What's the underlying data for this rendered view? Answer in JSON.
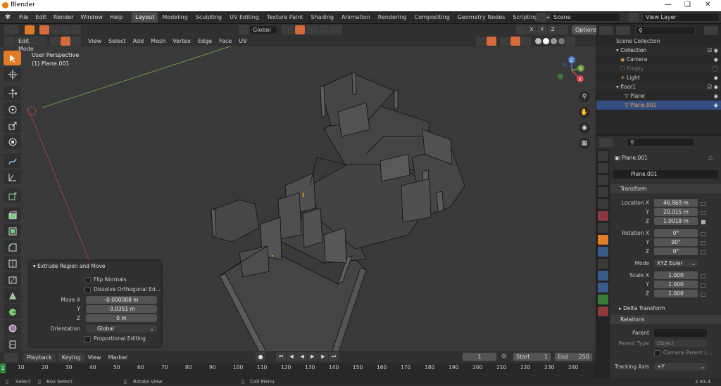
{
  "window": {
    "title": "Blender"
  },
  "menus": [
    "File",
    "Edit",
    "Render",
    "Window",
    "Help"
  ],
  "workspaces": [
    "Layout",
    "Modeling",
    "Sculpting",
    "UV Editing",
    "Texture Paint",
    "Shading",
    "Animation",
    "Rendering",
    "Compositing",
    "Geometry Nodes",
    "Scripting"
  ],
  "topbar": {
    "add_tab": "+",
    "scene": "Scene",
    "view_layer": "View Layer"
  },
  "viewport": {
    "orientation": "Global",
    "options": "Options",
    "axes": [
      "X",
      "Y",
      "Z"
    ],
    "mode": "Edit Mode",
    "header_menus": [
      "View",
      "Select",
      "Add",
      "Mesh",
      "Vertex",
      "Edge",
      "Face",
      "UV"
    ],
    "perspective": "User Perspective",
    "object": "(1) Plane.001",
    "gizmo": {
      "x": "X",
      "y": "Y",
      "z": "Z"
    }
  },
  "operator_panel": {
    "title": "Extrude Region and Move",
    "flip_normals": "Flip Normals",
    "dissolve": "Dissolve Orthogonal Ed...",
    "move_x_label": "Move X",
    "move_x": "-0.000008 m",
    "y_label": "Y",
    "move_y": "-3.0351 m",
    "z_label": "Z",
    "move_z": "0 m",
    "orientation_label": "Orientation",
    "orientation": "Global",
    "proportional": "Proportional Editing"
  },
  "outliner": {
    "rows": [
      {
        "label": "Scene Collection"
      },
      {
        "label": "Collection"
      },
      {
        "label": "Camera"
      },
      {
        "label": "Empty"
      },
      {
        "label": "Light"
      },
      {
        "label": "floor1"
      },
      {
        "label": "Plane"
      },
      {
        "label": "Plane.001"
      }
    ]
  },
  "properties": {
    "object_name": "Plane.001",
    "data_name": "Plane.001",
    "transform": "Transform",
    "location_x_label": "Location X",
    "location_x": "46.869 m",
    "location_y_label": "Y",
    "location_y": "20.015 m",
    "location_z_label": "Z",
    "location_z": "1.0018 m",
    "rotation_x_label": "Rotation X",
    "rotation_x": "0°",
    "rotation_y_label": "Y",
    "rotation_y": "90°",
    "rotation_z_label": "Z",
    "rotation_z": "0°",
    "mode_label": "Mode",
    "mode": "XYZ Euler",
    "scale_x_label": "Scale X",
    "scale_x": "1.000",
    "scale_y_label": "Y",
    "scale_y": "1.000",
    "scale_z_label": "Z",
    "scale_z": "1.000",
    "delta": "Delta Transform",
    "relations": "Relations",
    "parent_label": "Parent",
    "parent_type_label": "Parent Type",
    "parent_type": "Object",
    "camera_parent": "Camera Parent L...",
    "tracking_label": "Tracking Axis",
    "tracking": "+Y"
  },
  "timeline": {
    "playback": "Playback",
    "keying": "Keying",
    "view": "View",
    "marker": "Marker",
    "current": "1",
    "start_label": "Start",
    "start": "1",
    "end_label": "End",
    "end": "250",
    "ruler": [
      "10",
      "20",
      "30",
      "40",
      "50",
      "60",
      "70",
      "80",
      "90",
      "100",
      "110",
      "120",
      "130",
      "140",
      "150",
      "160",
      "170",
      "180",
      "190",
      "200",
      "210",
      "220",
      "230",
      "240"
    ],
    "frame_marker": "1"
  },
  "status": {
    "select": "Select",
    "box_select": "Box Select",
    "rotate": "Rotate View",
    "call_menu": "Call Menu",
    "version": "2.93.4"
  }
}
